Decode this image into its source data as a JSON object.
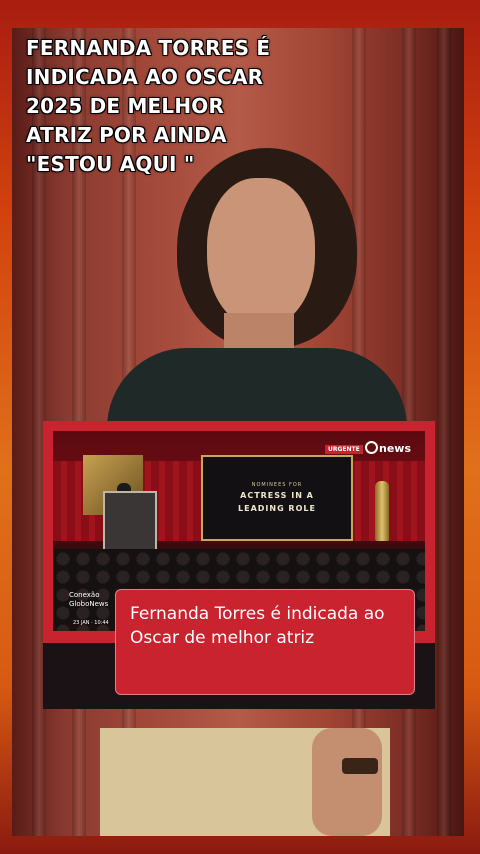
{
  "headline": {
    "lines": [
      "FERNANDA TORRES É",
      "INDICADA AO OSCAR",
      "2025 DE MELHOR",
      "ATRIZ POR AINDA",
      "\"ESTOU AQUI \""
    ]
  },
  "news_clip": {
    "urgent_badge": "URGENTE",
    "channel_logo": "news",
    "screen_small": "NOMINEES FOR",
    "screen_line1": "ACTRESS IN A",
    "screen_line2": "LEADING ROLE",
    "program_name_1": "Conexão",
    "program_name_2": "GloboNews",
    "program_date": "23 JAN · 10:44",
    "caption": "Fernanda Torres é indicada ao Oscar de melhor atriz"
  },
  "colors": {
    "frame_orange": "#e05a12",
    "news_red": "#c8232f"
  }
}
